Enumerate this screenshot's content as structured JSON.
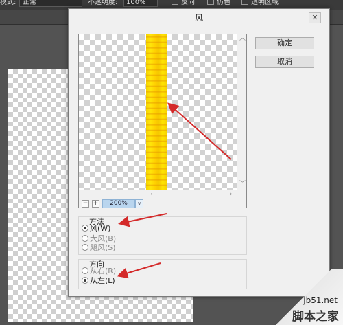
{
  "toolbar": {
    "mode_label": "模式:",
    "mode_value": "正常",
    "opacity_label": "不透明度:",
    "opacity_value": "100%",
    "checkboxes": [
      {
        "label": "反向"
      },
      {
        "label": "仿色"
      },
      {
        "label": "透明区域"
      }
    ]
  },
  "dialog": {
    "title": "风",
    "close_icon": "close-icon",
    "ok_label": "确定",
    "cancel_label": "取消",
    "zoom": "200%",
    "method_group": {
      "title": "方法",
      "options": [
        {
          "label": "风(W)",
          "selected": true,
          "enabled": true
        },
        {
          "label": "大风(B)",
          "selected": false,
          "enabled": false
        },
        {
          "label": "飓风(S)",
          "selected": false,
          "enabled": false
        }
      ]
    },
    "direction_group": {
      "title": "方向",
      "options": [
        {
          "label": "从右(R)",
          "selected": false,
          "enabled": false
        },
        {
          "label": "从左(L)",
          "selected": true,
          "enabled": true
        }
      ]
    }
  },
  "watermark": {
    "url": "jb51.net",
    "brand": "脚本之家"
  },
  "colors": {
    "annotation_arrow": "#d42a2a",
    "streak_yellow": "#ffe000"
  }
}
